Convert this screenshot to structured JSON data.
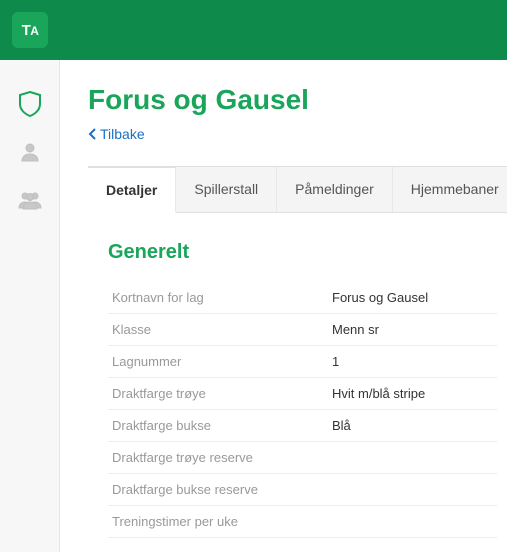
{
  "logo": "TA",
  "header": {
    "title": "Forus og Gausel",
    "back_label": "Tilbake"
  },
  "tabs": [
    {
      "label": "Detaljer",
      "active": true
    },
    {
      "label": "Spillerstall",
      "active": false
    },
    {
      "label": "Påmeldinger",
      "active": false
    },
    {
      "label": "Hjemmebaner",
      "active": false
    }
  ],
  "section": {
    "title": "Generelt"
  },
  "details": [
    {
      "label": "Kortnavn for lag",
      "value": "Forus og Gausel"
    },
    {
      "label": "Klasse",
      "value": "Menn sr"
    },
    {
      "label": "Lagnummer",
      "value": "1"
    },
    {
      "label": "Draktfarge trøye",
      "value": "Hvit m/blå stripe"
    },
    {
      "label": "Draktfarge bukse",
      "value": "Blå"
    },
    {
      "label": "Draktfarge trøye reserve",
      "value": ""
    },
    {
      "label": "Draktfarge bukse reserve",
      "value": ""
    },
    {
      "label": "Treningstimer per uke",
      "value": ""
    }
  ]
}
